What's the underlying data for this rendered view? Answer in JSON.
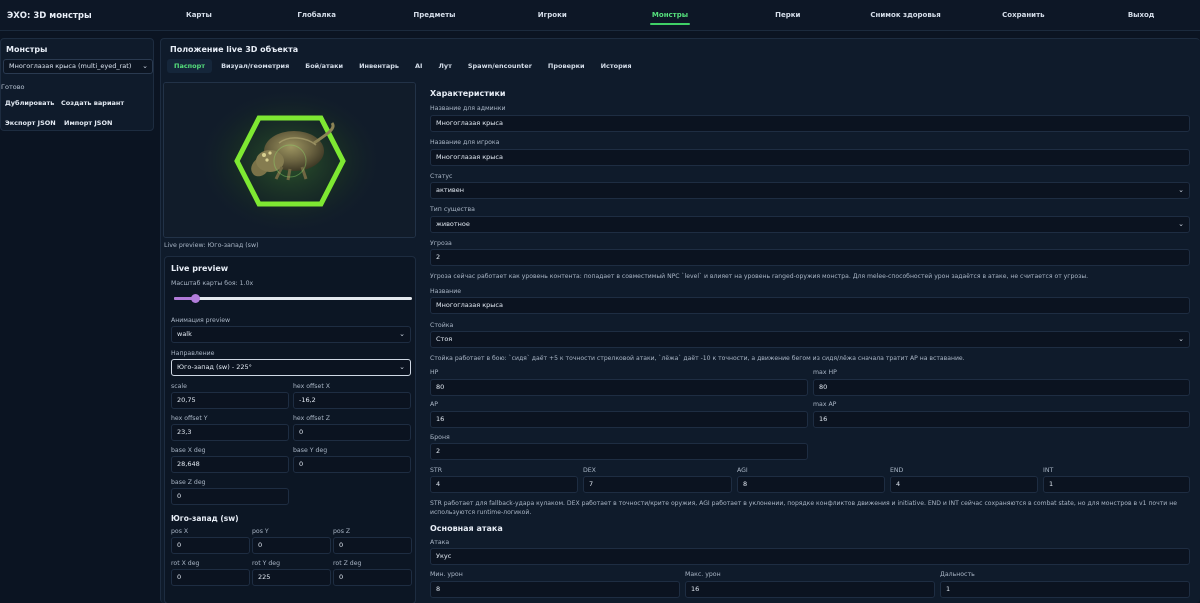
{
  "app": {
    "title": "ЭХО: 3D монстры"
  },
  "nav": {
    "items": [
      {
        "label": "Карты",
        "name": "nav-maps"
      },
      {
        "label": "Глобалка",
        "name": "nav-global"
      },
      {
        "label": "Предметы",
        "name": "nav-items"
      },
      {
        "label": "Игроки",
        "name": "nav-players"
      },
      {
        "label": "Монстры",
        "name": "nav-monsters",
        "active": true
      },
      {
        "label": "Перки",
        "name": "nav-perks"
      },
      {
        "label": "Снимок здоровья",
        "name": "nav-health-snapshot"
      },
      {
        "label": "Сохранить",
        "name": "nav-save"
      },
      {
        "label": "Выход",
        "name": "nav-logout"
      }
    ],
    "accent": "#3fd066"
  },
  "sidebar": {
    "title": "Монстры",
    "selected_monster": "Многоглазая крыса (multi_eyed_rat)",
    "status": "Готово",
    "duplicate_label": "Дублировать",
    "create_variant_label": "Создать вариант",
    "export_label": "Экспорт JSON",
    "import_label": "Импорт JSON"
  },
  "main": {
    "title": "Положение live 3D объекта",
    "tabs": [
      {
        "label": "Паспорт",
        "active": true
      },
      {
        "label": "Визуал/геометрия"
      },
      {
        "label": "Бой/атаки"
      },
      {
        "label": "Инвентарь"
      },
      {
        "label": "AI"
      },
      {
        "label": "Лут"
      },
      {
        "label": "Spawn/encounter"
      },
      {
        "label": "Проверки"
      },
      {
        "label": "История"
      }
    ]
  },
  "preview": {
    "caption": "Live preview: Юго-запад (sw)",
    "hex_color": "#7ee832"
  },
  "live_preview": {
    "title": "Live preview",
    "scale_label": "Масштаб карты боя: 1.0x",
    "scale_fraction": 0.09,
    "animation_label": "Анимация preview",
    "animation_value": "walk",
    "direction_label": "Направление",
    "direction_value": "Юго-запад (sw) - 225°",
    "scale_field_label": "scale",
    "scale_value": "20,75",
    "hex_offset_x_label": "hex offset X",
    "hex_offset_x": "-16,2",
    "hex_offset_y_label": "hex offset Y",
    "hex_offset_y": "23,3",
    "hex_offset_z_label": "hex offset Z",
    "hex_offset_z": "0",
    "base_x_label": "base X deg",
    "base_x": "28,648",
    "base_y_label": "base Y deg",
    "base_y": "0",
    "base_z_label": "base Z deg",
    "base_z": "0",
    "pose_title": "Юго-запад (sw)",
    "pos_x_label": "pos X",
    "pos_x": "0",
    "pos_y_label": "pos Y",
    "pos_y": "0",
    "pos_z_label": "pos Z",
    "pos_z": "0",
    "rot_x_label": "rot X deg",
    "rot_x": "0",
    "rot_y_label": "rot Y deg",
    "rot_y": "225",
    "rot_z_label": "rot Z deg",
    "rot_z": "0"
  },
  "form": {
    "section_title": "Характеристики",
    "admin_name_label": "Название для админки",
    "admin_name": "Многоглазая крыса",
    "player_name_label": "Название для игрока",
    "player_name": "Многоглазая крыса",
    "status_label": "Статус",
    "status_value": "активен",
    "creature_type_label": "Тип существа",
    "creature_type_value": "животное",
    "threat_label": "Угроза",
    "threat_value": "2",
    "threat_note": "Угроза сейчас работает как уровень контента: попадает в совместимый NPC `level` и влияет на уровень ranged-оружия монстра. Для melee-способностей урон задаётся в атаке, не считается от угрозы.",
    "name_label": "Название",
    "name_value": "Многоглазая крыса",
    "stance_label": "Стойка",
    "stance_value": "Стоя",
    "stance_note": "Стойка работает в бою: `сидя` даёт +5 к точности стрелковой атаки, `лёжа` даёт -10 к точности, а движение бегом из сидя/лёжа сначала тратит AP на вставание.",
    "hp_label": "HP",
    "hp_value": "80",
    "max_hp_label": "max HP",
    "max_hp_value": "80",
    "ap_label": "AP",
    "ap_value": "16",
    "max_ap_label": "max AP",
    "max_ap_value": "16",
    "armor_label": "Броня",
    "armor_value": "2",
    "str_label": "STR",
    "str_value": "4",
    "dex_label": "DEX",
    "dex_value": "7",
    "agi_label": "AGI",
    "agi_value": "8",
    "end_label": "END",
    "end_value": "4",
    "int_label": "INT",
    "int_value": "1",
    "attributes_note": "STR работает для fallback-удара кулаком. DEX работает в точности/крите оружия, AGI работает в уклонении, порядке конфликтов движения и initiative. END и INT сейчас сохраняются в combat state, но для монстров в v1 почти не используются runtime-логикой.",
    "attack_section_title": "Основная атака",
    "attack_label": "Атака",
    "attack_value": "Укус",
    "min_damage_label": "Мин. урон",
    "min_damage_value": "8",
    "max_damage_label": "Макс. урон",
    "max_damage_value": "16",
    "range_label": "Дальность",
    "range_value": "1"
  }
}
